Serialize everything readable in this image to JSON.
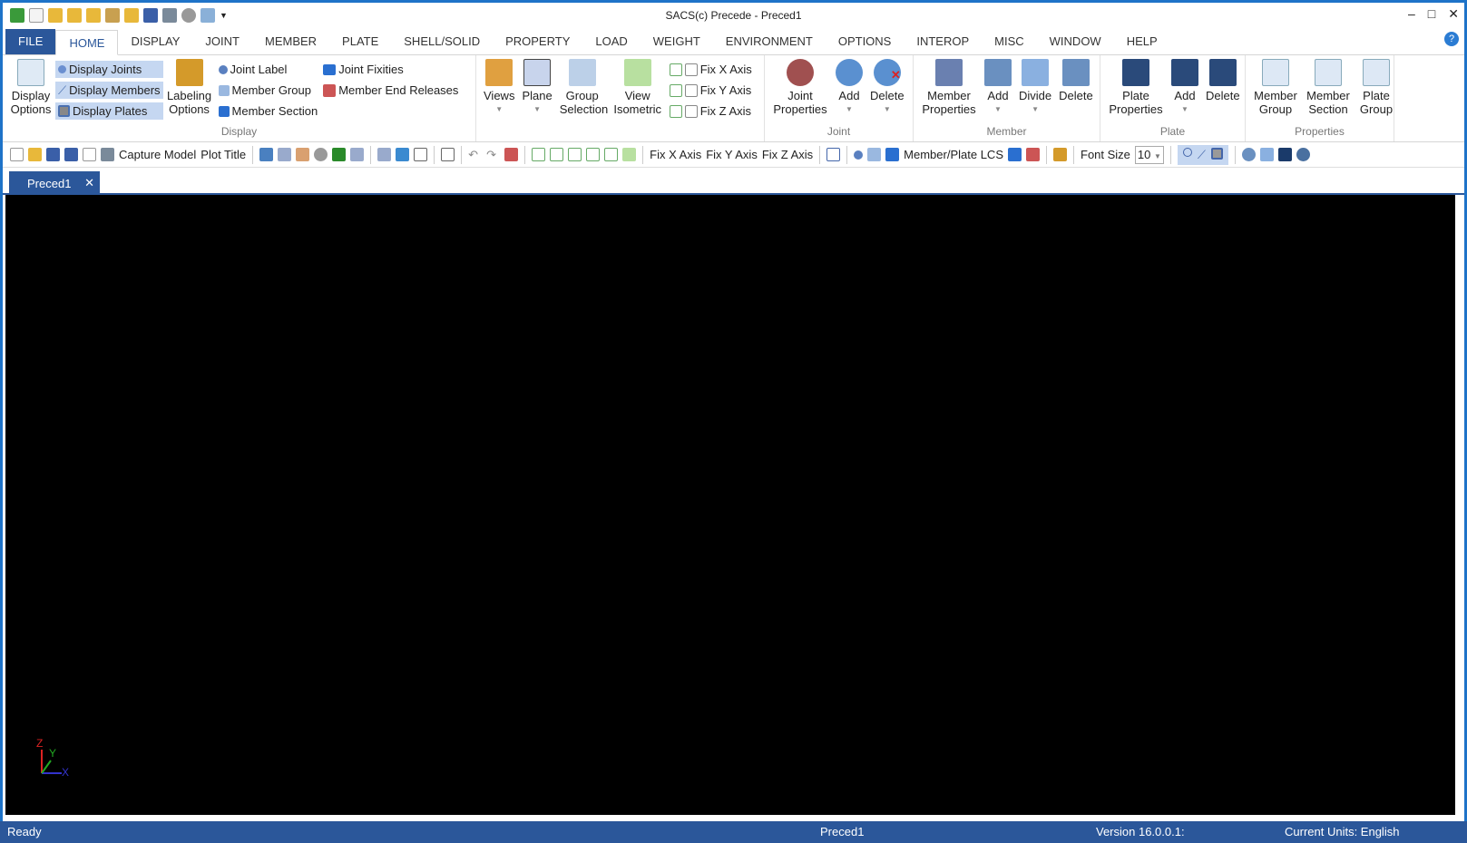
{
  "window": {
    "title": "SACS(c) Precede - Preced1",
    "minimize": "–",
    "maximize": "□",
    "close": "✕"
  },
  "menu": {
    "tabs": [
      "FILE",
      "HOME",
      "DISPLAY",
      "JOINT",
      "MEMBER",
      "PLATE",
      "SHELL/SOLID",
      "PROPERTY",
      "LOAD",
      "WEIGHT",
      "ENVIRONMENT",
      "OPTIONS",
      "INTEROP",
      "MISC",
      "WINDOW",
      "HELP"
    ],
    "help": "?"
  },
  "ribbon": {
    "display": {
      "label": "Display",
      "display_options": "Display Options",
      "display_joints": "Display Joints",
      "display_members": "Display Members",
      "display_plates": "Display Plates",
      "labeling_options": "Labeling Options",
      "joint_label": "Joint Label",
      "member_group": "Member Group",
      "member_section": "Member Section",
      "joint_fixities": "Joint Fixities",
      "member_end_releases": "Member End Releases"
    },
    "view": {
      "views": "Views",
      "plane": "Plane",
      "group_selection": "Group Selection",
      "view_isometric": "View Isometric",
      "fix_x": "Fix X Axis",
      "fix_y": "Fix Y Axis",
      "fix_z": "Fix Z Axis"
    },
    "joint": {
      "label": "Joint",
      "properties": "Joint Properties",
      "add": "Add",
      "delete": "Delete"
    },
    "member": {
      "label": "Member",
      "properties": "Member Properties",
      "add": "Add",
      "divide": "Divide",
      "delete": "Delete"
    },
    "plate": {
      "label": "Plate",
      "properties": "Plate Properties",
      "add": "Add",
      "delete": "Delete"
    },
    "properties": {
      "label": "Properties",
      "member_group": "Member Group",
      "member_section": "Member Section",
      "plate_group": "Plate Group"
    }
  },
  "toolbar": {
    "capture_model": "Capture Model",
    "plot_title": "Plot Title",
    "fix_x": "Fix X Axis",
    "fix_y": "Fix Y Axis",
    "fix_z": "Fix Z Axis",
    "lcs": "Member/Plate LCS",
    "font_size_label": "Font Size",
    "font_size": "10"
  },
  "doc_tab": {
    "name": "Preced1",
    "close": "✕"
  },
  "triad": {
    "x": "X",
    "y": "Y",
    "z": "Z"
  },
  "status": {
    "state": "Ready",
    "document": "Preced1",
    "version": "Version 16.0.0.1:",
    "units": "Current Units: English"
  },
  "colors": {
    "accent": "#2b579a",
    "viewport": "#000000",
    "selected": "#c5d7f1"
  }
}
